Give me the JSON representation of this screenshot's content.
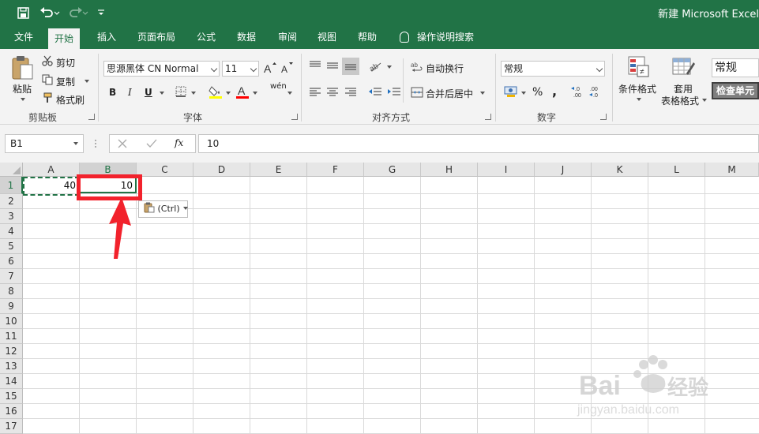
{
  "titlebar": {
    "document_title": "新建 Microsoft Excel"
  },
  "tabs": [
    {
      "label": "文件"
    },
    {
      "label": "开始"
    },
    {
      "label": "插入"
    },
    {
      "label": "页面布局"
    },
    {
      "label": "公式"
    },
    {
      "label": "数据"
    },
    {
      "label": "审阅"
    },
    {
      "label": "视图"
    },
    {
      "label": "帮助"
    }
  ],
  "active_tab": "开始",
  "tell_me": "操作说明搜索",
  "ribbon": {
    "clipboard": {
      "paste": "粘贴",
      "cut": "剪切",
      "copy": "复制",
      "format_painter": "格式刷",
      "group_label": "剪贴板"
    },
    "font": {
      "font_name": "思源黑体 CN Normal",
      "font_size": "11",
      "bold": "B",
      "italic": "I",
      "underline": "U",
      "font_color_glyph": "A",
      "phonetic_glyph": "wén",
      "group_label": "字体"
    },
    "alignment": {
      "wrap_text": "自动换行",
      "merge_center": "合并后居中",
      "group_label": "对齐方式"
    },
    "number": {
      "format": "常规",
      "percent": "%",
      "comma": ",",
      "group_label": "数字"
    },
    "styles": {
      "conditional_formatting": "条件格式",
      "format_as_table_line1": "套用",
      "format_as_table_line2": "表格格式",
      "cell_style_normal": "常规",
      "cell_style_check": "检查单元"
    }
  },
  "formula_bar": {
    "name_box": "B1",
    "fx": "fx",
    "value": "10"
  },
  "sheet": {
    "columns": [
      "A",
      "B",
      "C",
      "D",
      "E",
      "F",
      "G",
      "H",
      "I",
      "J",
      "K",
      "L",
      "M"
    ],
    "rows": [
      "1",
      "2",
      "3",
      "4",
      "5",
      "6",
      "7",
      "8",
      "9",
      "10",
      "11",
      "12",
      "13",
      "14",
      "15",
      "16",
      "17"
    ],
    "cells": {
      "A1": "40",
      "B1": "10"
    },
    "active_cell": "B1",
    "copied_range": "A1"
  },
  "paste_options": {
    "label": "(Ctrl)"
  },
  "colors": {
    "excel_green": "#217346",
    "annotation_red": "#f2222c"
  }
}
